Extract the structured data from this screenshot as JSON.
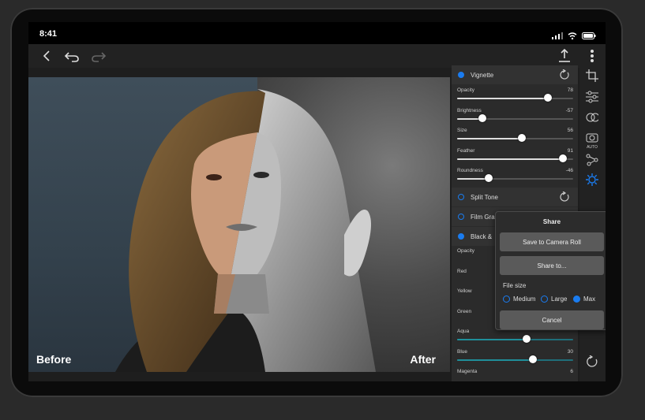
{
  "status": {
    "time": "8:41"
  },
  "photo": {
    "before_label": "Before",
    "after_label": "After"
  },
  "panel": {
    "vignette": {
      "label": "Vignette",
      "checked": true
    },
    "vignette_sliders": [
      {
        "label": "Opacity",
        "value": "78",
        "level": 0.78
      },
      {
        "label": "Brightness",
        "value": "-57",
        "level": 0.215
      },
      {
        "label": "Size",
        "value": "56",
        "level": 0.56
      },
      {
        "label": "Feather",
        "value": "91",
        "level": 0.91
      },
      {
        "label": "Roundness",
        "value": "-46",
        "level": 0.27
      }
    ],
    "split_tone": {
      "label": "Split Tone"
    },
    "film_grain": {
      "label": "Film Gra"
    },
    "bw": {
      "label": "Black & "
    },
    "bw_sliders": [
      {
        "label": "Opacity",
        "value": ""
      },
      {
        "label": "Red",
        "value": ""
      },
      {
        "label": "Yellow",
        "value": ""
      },
      {
        "label": "Green",
        "value": ""
      },
      {
        "label": "Aqua",
        "value": "",
        "level": 0.6
      },
      {
        "label": "Blue",
        "value": "30",
        "level": 0.65
      },
      {
        "label": "Magenta",
        "value": "6"
      }
    ]
  },
  "share": {
    "title": "Share",
    "save_label": "Save to Camera Roll",
    "share_to_label": "Share to...",
    "file_size_label": "File size",
    "options": [
      "Medium",
      "Large",
      "Max"
    ],
    "selected": "Max",
    "cancel_label": "Cancel"
  },
  "colors": {
    "accent": "#1a7cf0",
    "panel_bg": "#2b2b2b",
    "toolbar_bg": "#222222"
  },
  "icons": {
    "toolbar": [
      "back-icon",
      "undo-icon",
      "redo-icon",
      "export-icon",
      "more-icon"
    ],
    "rightbar": [
      "crop-icon",
      "adjust-icon",
      "blend-icon",
      "auto-camera-icon",
      "nodes-icon",
      "effects-gear-icon",
      "reset-icon"
    ]
  }
}
